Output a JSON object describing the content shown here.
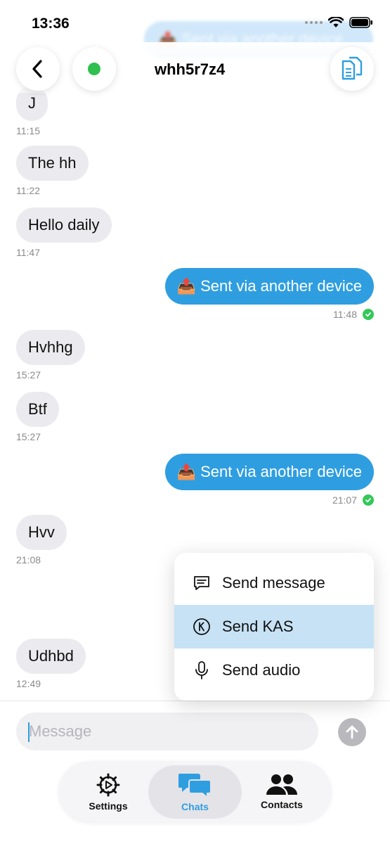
{
  "status_bar": {
    "time": "13:36"
  },
  "header": {
    "title": "whh5r7z4",
    "back_icon": "chevron-left-icon",
    "status_icon": "online-dot-icon",
    "copy_icon": "copy-icon",
    "online_color": "#2fbf4f"
  },
  "ghost_message": "📤 Sent via another device",
  "messages": [
    {
      "direction": "in",
      "text": "J",
      "time": "11:15"
    },
    {
      "direction": "in",
      "text": "The hh",
      "time": "11:22"
    },
    {
      "direction": "in",
      "text": "Hello daily",
      "time": "11:47"
    },
    {
      "direction": "out",
      "text": "📤 Sent via another device",
      "time": "11:48",
      "status": "delivered"
    },
    {
      "direction": "in",
      "text": "Hvhhg",
      "time": "15:27"
    },
    {
      "direction": "in",
      "text": "Btf",
      "time": "15:27"
    },
    {
      "direction": "out",
      "text": "📤 Sent via another device",
      "time": "21:07",
      "status": "delivered"
    },
    {
      "direction": "in",
      "text": "Hvv",
      "time": "21:08"
    },
    {
      "direction": "in",
      "text": "Udhbd",
      "time": "12:49"
    }
  ],
  "popup_menu": {
    "items": [
      {
        "label": "Send message",
        "icon": "message-icon",
        "highlighted": false
      },
      {
        "label": "Send KAS",
        "icon": "kaspa-coin-icon",
        "highlighted": true
      },
      {
        "label": "Send audio",
        "icon": "microphone-icon",
        "highlighted": false
      }
    ]
  },
  "composer": {
    "placeholder": "Message",
    "send_icon": "arrow-up-icon"
  },
  "tabbar": {
    "tabs": [
      {
        "label": "Settings",
        "icon": "gear-icon",
        "active": false
      },
      {
        "label": "Chats",
        "icon": "chat-bubbles-icon",
        "active": true
      },
      {
        "label": "Contacts",
        "icon": "people-icon",
        "active": false
      }
    ]
  },
  "colors": {
    "accent": "#2f9ee0",
    "incoming_bubble": "#ebebef",
    "delivered": "#34c759",
    "highlight": "#c6e2f4"
  }
}
